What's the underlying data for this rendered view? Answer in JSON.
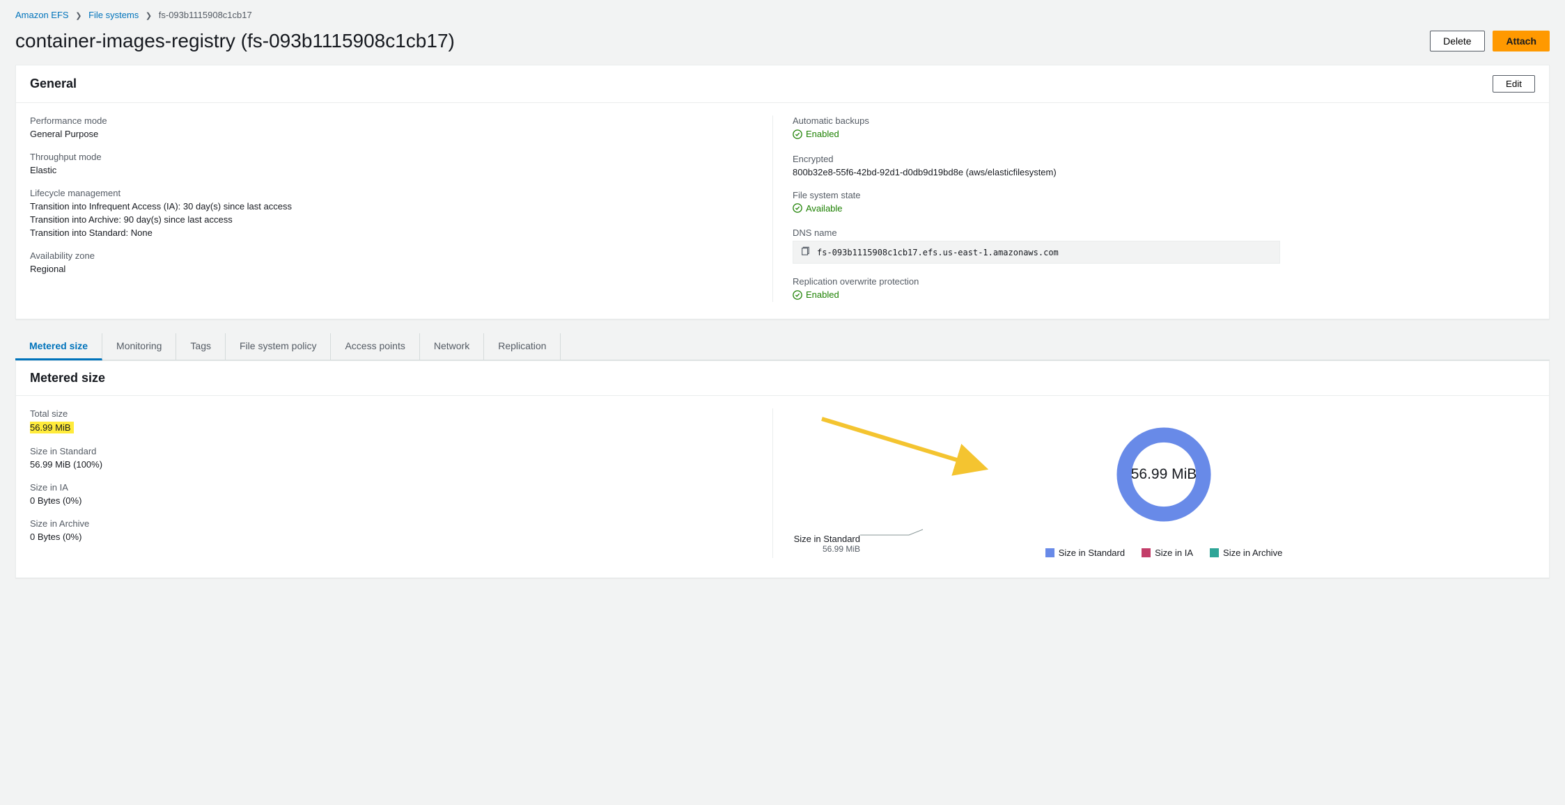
{
  "breadcrumbs": {
    "root": "Amazon EFS",
    "parent": "File systems",
    "current": "fs-093b1115908c1cb17"
  },
  "title": "container-images-registry (fs-093b1115908c1cb17)",
  "buttons": {
    "delete": "Delete",
    "attach": "Attach",
    "edit": "Edit"
  },
  "general": {
    "heading": "General",
    "perf_label": "Performance mode",
    "perf_val": "General Purpose",
    "throughput_label": "Throughput mode",
    "throughput_val": "Elastic",
    "lifecycle_label": "Lifecycle management",
    "lifecycle_ia": "Transition into Infrequent Access (IA): 30 day(s) since last access",
    "lifecycle_archive": "Transition into Archive: 90 day(s) since last access",
    "lifecycle_standard": "Transition into Standard: None",
    "az_label": "Availability zone",
    "az_val": "Regional",
    "backups_label": "Automatic backups",
    "backups_val": "Enabled",
    "encrypted_label": "Encrypted",
    "encrypted_val": "800b32e8-55f6-42bd-92d1-d0db9d19bd8e (aws/elasticfilesystem)",
    "state_label": "File system state",
    "state_val": "Available",
    "dns_label": "DNS name",
    "dns_val": "fs-093b1115908c1cb17.efs.us-east-1.amazonaws.com",
    "rep_label": "Replication overwrite protection",
    "rep_val": "Enabled"
  },
  "tabs": [
    "Metered size",
    "Monitoring",
    "Tags",
    "File system policy",
    "Access points",
    "Network",
    "Replication"
  ],
  "metered": {
    "heading": "Metered size",
    "total_label": "Total size",
    "total_val": "56.99 MiB",
    "std_label": "Size in Standard",
    "std_val": "56.99 MiB (100%)",
    "ia_label": "Size in IA",
    "ia_val": "0 Bytes (0%)",
    "arch_label": "Size in Archive",
    "arch_val": "0 Bytes (0%)",
    "donut_center": "56.99 MiB",
    "leader_label": "Size in Standard",
    "leader_val": "56.99 MiB",
    "legend_std": "Size in Standard",
    "legend_ia": "Size in IA",
    "legend_arch": "Size in Archive"
  },
  "colors": {
    "std": "#688ae8",
    "ia": "#c33d69",
    "arch": "#2ea597"
  },
  "chart_data": {
    "type": "pie",
    "title": "Metered size",
    "categories": [
      "Size in Standard",
      "Size in IA",
      "Size in Archive"
    ],
    "values": [
      56.99,
      0,
      0
    ],
    "unit": "MiB",
    "center_label": "56.99 MiB"
  }
}
